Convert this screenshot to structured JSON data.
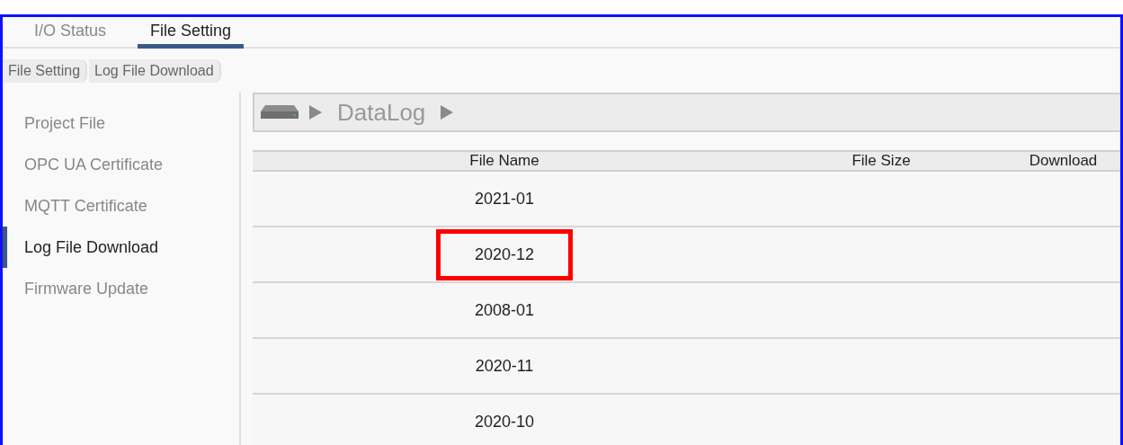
{
  "tabs": [
    {
      "label": "I/O Status",
      "selected": false
    },
    {
      "label": "File Setting",
      "selected": true
    }
  ],
  "breadcrumb": [
    "File Setting",
    "Log File Download"
  ],
  "sidebar": {
    "items": [
      {
        "label": "Project File",
        "selected": false
      },
      {
        "label": "OPC UA Certificate",
        "selected": false
      },
      {
        "label": "MQTT Certificate",
        "selected": false
      },
      {
        "label": "Log File Download",
        "selected": true
      },
      {
        "label": "Firmware Update",
        "selected": false
      }
    ]
  },
  "path": {
    "folder": "DataLog"
  },
  "table": {
    "columns": [
      "File Name",
      "File Size",
      "Download"
    ],
    "rows": [
      {
        "file_name": "2021-01",
        "highlighted": false
      },
      {
        "file_name": "2020-12",
        "highlighted": true
      },
      {
        "file_name": "2008-01",
        "highlighted": false
      },
      {
        "file_name": "2020-11",
        "highlighted": false
      },
      {
        "file_name": "2020-10",
        "highlighted": false
      }
    ]
  }
}
